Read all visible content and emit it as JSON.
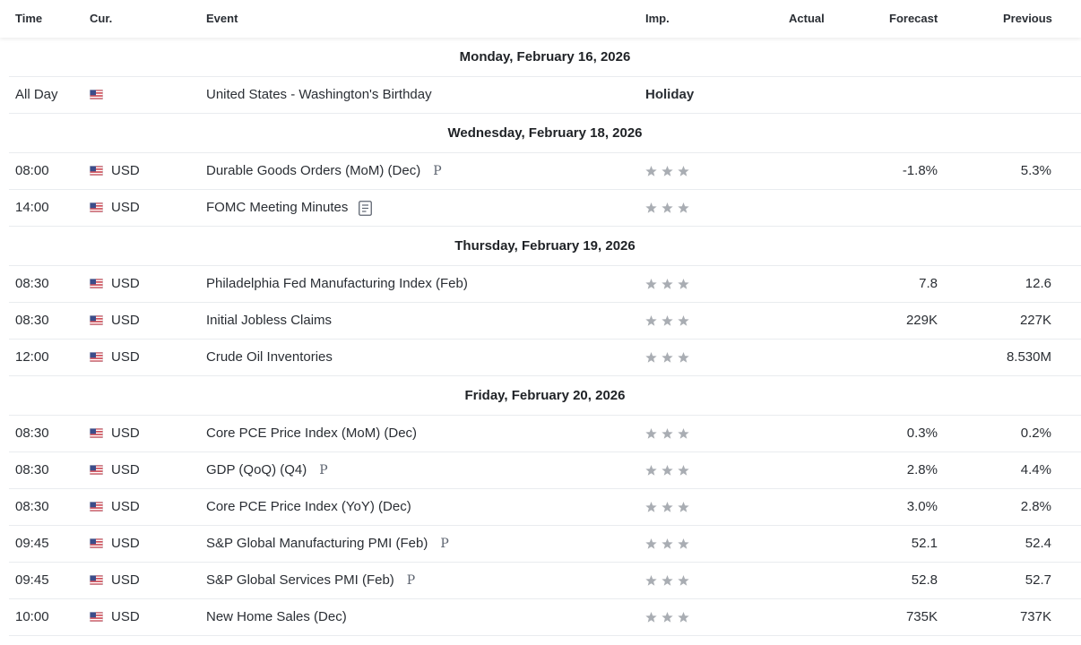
{
  "header": {
    "time": "Time",
    "cur": "Cur.",
    "event": "Event",
    "imp": "Imp.",
    "actual": "Actual",
    "forecast": "Forecast",
    "previous": "Previous"
  },
  "colors": {
    "star": "#a9adb3",
    "flag_red": "#c8313e",
    "flag_blue": "#3c4c8a"
  },
  "days": {
    "mon": "Monday, February 16, 2026",
    "wed": "Wednesday, February 18, 2026",
    "thu": "Thursday, February 19, 2026",
    "fri": "Friday, February 20, 2026"
  },
  "holiday_row": {
    "time": "All Day",
    "event": "United States - Washington's Birthday",
    "imp": "Holiday"
  },
  "rows": [
    {
      "time": "08:00",
      "cur": "USD",
      "event": "Durable Goods Orders (MoM) (Dec)",
      "badge": "P",
      "actual": "",
      "forecast": "-1.8%",
      "previous": "5.3%"
    },
    {
      "time": "14:00",
      "cur": "USD",
      "event": "FOMC Meeting Minutes",
      "icon": "document-icon",
      "actual": "",
      "forecast": "",
      "previous": ""
    },
    {
      "time": "08:30",
      "cur": "USD",
      "event": "Philadelphia Fed Manufacturing Index (Feb)",
      "actual": "",
      "forecast": "7.8",
      "previous": "12.6"
    },
    {
      "time": "08:30",
      "cur": "USD",
      "event": "Initial Jobless Claims",
      "actual": "",
      "forecast": "229K",
      "previous": "227K"
    },
    {
      "time": "12:00",
      "cur": "USD",
      "event": "Crude Oil Inventories",
      "actual": "",
      "forecast": "",
      "previous": "8.530M"
    },
    {
      "time": "08:30",
      "cur": "USD",
      "event": "Core PCE Price Index (MoM) (Dec)",
      "actual": "",
      "forecast": "0.3%",
      "previous": "0.2%"
    },
    {
      "time": "08:30",
      "cur": "USD",
      "event": "GDP (QoQ) (Q4)",
      "badge": "P",
      "actual": "",
      "forecast": "2.8%",
      "previous": "4.4%"
    },
    {
      "time": "08:30",
      "cur": "USD",
      "event": "Core PCE Price Index (YoY) (Dec)",
      "actual": "",
      "forecast": "3.0%",
      "previous": "2.8%"
    },
    {
      "time": "09:45",
      "cur": "USD",
      "event": "S&P Global Manufacturing PMI (Feb)",
      "badge": "P",
      "actual": "",
      "forecast": "52.1",
      "previous": "52.4"
    },
    {
      "time": "09:45",
      "cur": "USD",
      "event": "S&P Global Services PMI (Feb)",
      "badge": "P",
      "actual": "",
      "forecast": "52.8",
      "previous": "52.7"
    },
    {
      "time": "10:00",
      "cur": "USD",
      "event": "New Home Sales (Dec)",
      "actual": "",
      "forecast": "735K",
      "previous": "737K"
    }
  ]
}
